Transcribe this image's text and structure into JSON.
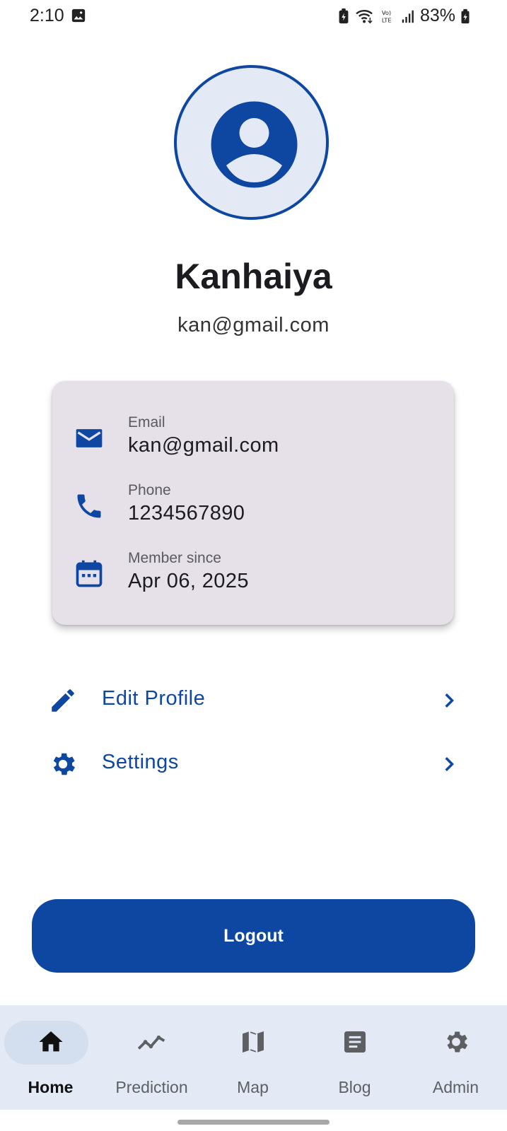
{
  "status_bar": {
    "time": "2:10",
    "battery": "83%",
    "icons": [
      "image-icon",
      "battery-saver-icon",
      "wifi-icon",
      "volte-icon",
      "signal-icon",
      "battery-charging-icon"
    ]
  },
  "profile": {
    "avatar_icon": "account-circle-icon",
    "name": "Kanhaiya",
    "email": "kan@gmail.com"
  },
  "info_card": {
    "rows": [
      {
        "icon": "mail-icon",
        "label": "Email",
        "value": "kan@gmail.com"
      },
      {
        "icon": "phone-icon",
        "label": "Phone",
        "value": "1234567890"
      },
      {
        "icon": "calendar-icon",
        "label": "Member since",
        "value": "Apr 06, 2025"
      }
    ]
  },
  "menu": [
    {
      "icon": "edit-icon",
      "label": "Edit Profile"
    },
    {
      "icon": "settings-icon",
      "label": "Settings"
    }
  ],
  "logout_label": "Logout",
  "bottom_nav": [
    {
      "icon": "home-icon",
      "label": "Home",
      "active": true
    },
    {
      "icon": "trending-icon",
      "label": "Prediction",
      "active": false
    },
    {
      "icon": "map-icon",
      "label": "Map",
      "active": false
    },
    {
      "icon": "article-icon",
      "label": "Blog",
      "active": false
    },
    {
      "icon": "settings-icon",
      "label": "Admin",
      "active": false
    }
  ],
  "colors": {
    "primary": "#0d47a1",
    "card_background": "#e6e1e8",
    "nav_background": "#e3eaf6",
    "text_primary": "#1c1b1f"
  }
}
